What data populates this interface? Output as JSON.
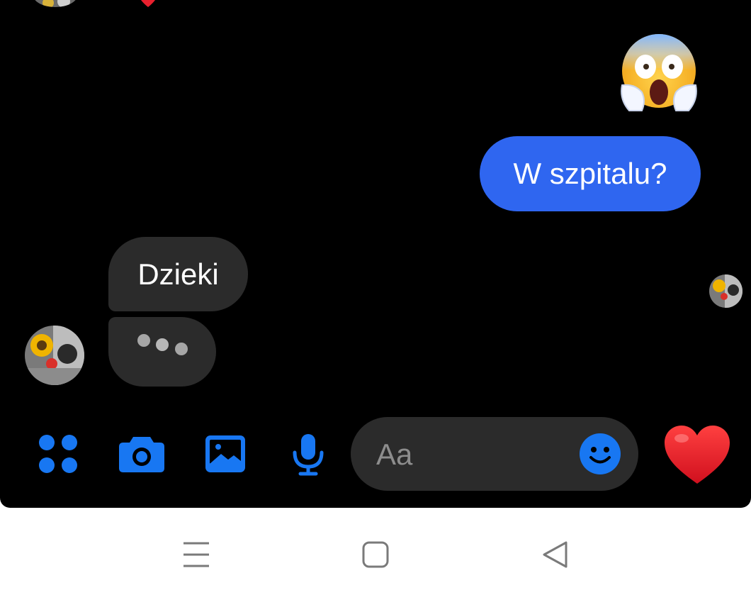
{
  "conversation": {
    "messages": [
      {
        "direction": "outgoing",
        "type": "emoji",
        "emoji_name": "face-screaming-in-fear"
      },
      {
        "direction": "outgoing",
        "type": "text",
        "text": "W szpitalu?"
      },
      {
        "direction": "incoming",
        "type": "text",
        "text": "Dzieki"
      }
    ],
    "typing_indicator": true
  },
  "composer": {
    "placeholder": "Aa",
    "value": ""
  },
  "toolbar": {
    "icons": [
      "apps-icon",
      "camera-icon",
      "gallery-icon",
      "microphone-icon",
      "emoji-icon",
      "like-heart-icon"
    ]
  },
  "navbar": {
    "icons": [
      "menu-icon",
      "home-icon",
      "back-icon"
    ]
  },
  "colors": {
    "background": "#000000",
    "accent_blue": "#1877f2",
    "outgoing_bubble": "#2f66f0",
    "incoming_bubble": "#2b2b2b",
    "heart_red": "#e8202e"
  }
}
